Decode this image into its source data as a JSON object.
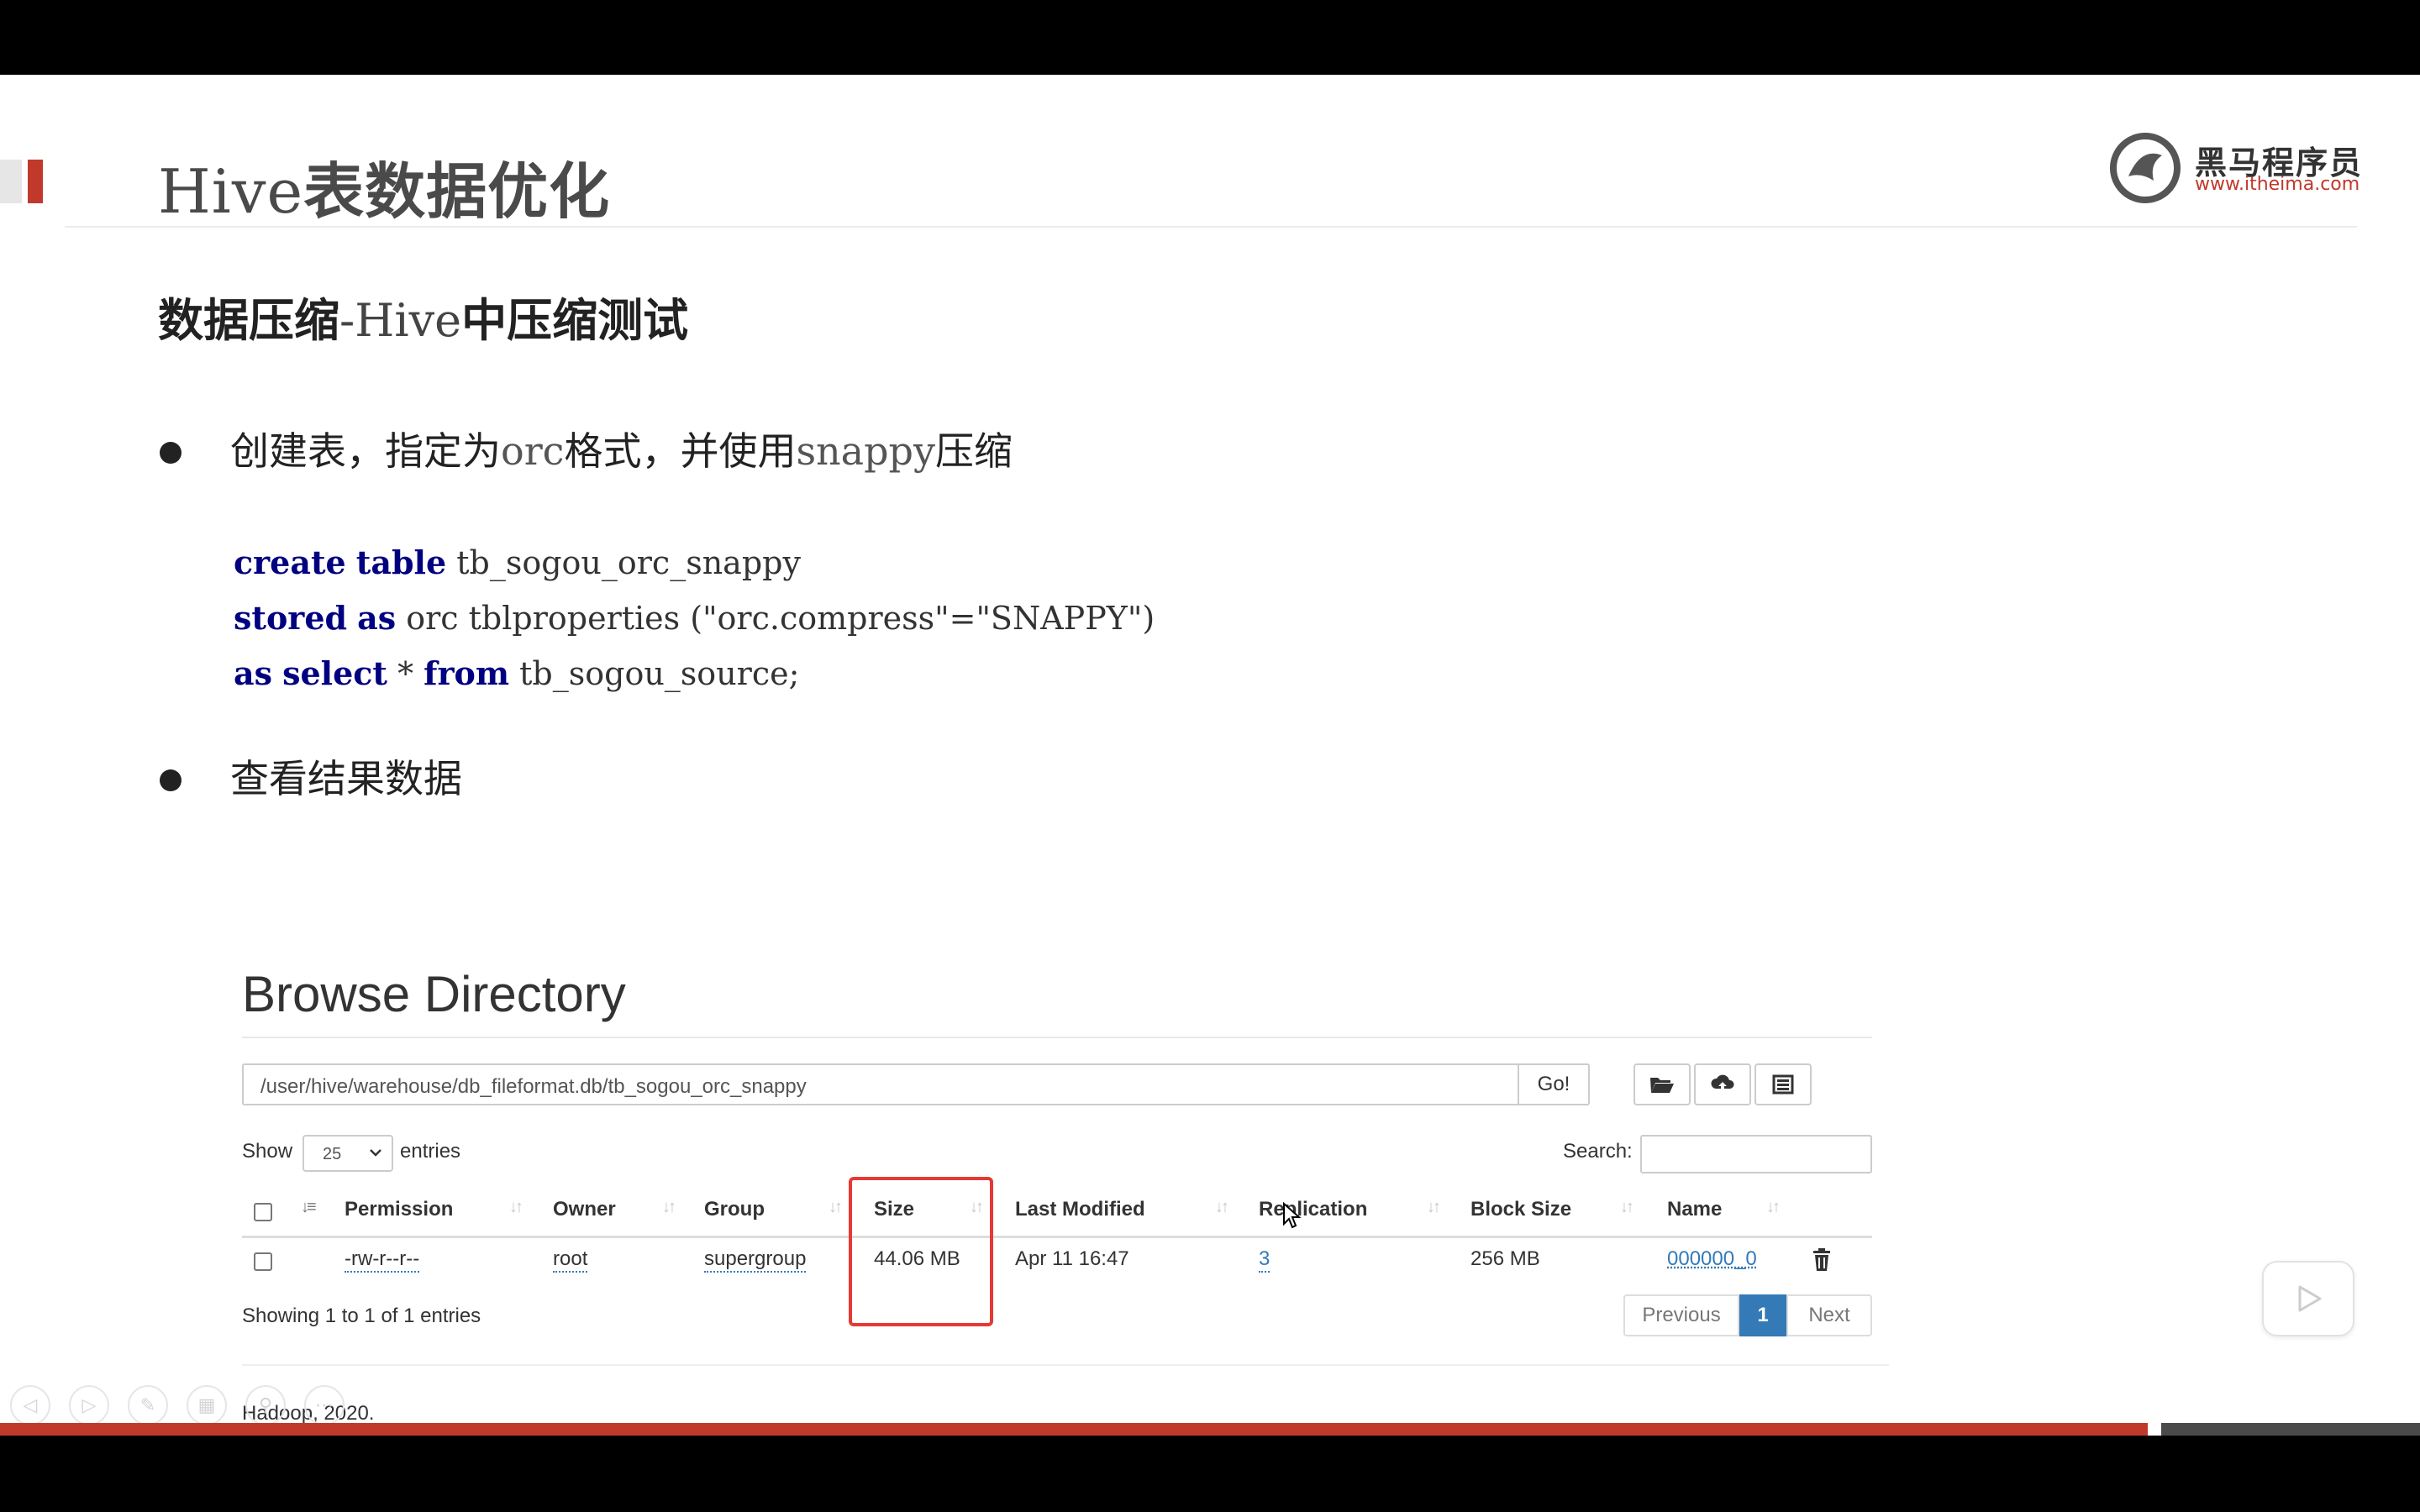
{
  "slide": {
    "title_latin": "Hive",
    "title_cn": "表数据优化",
    "logo_text": "黑马程序员",
    "logo_url": "www.itheima.com",
    "subtitle_part1": "数据压缩",
    "subtitle_part2": "-Hive",
    "subtitle_part3": "中压缩测试",
    "bullet1_parts": [
      "创建表，指定为",
      "orc",
      "格式，并使用",
      "snappy",
      "压缩"
    ],
    "code_lines": [
      [
        {
          "t": "create",
          "kw": true
        },
        {
          "t": " "
        },
        {
          "t": "table",
          "kw": true
        },
        {
          "t": " tb_sogou_orc_snappy"
        }
      ],
      [
        {
          "t": "stored",
          "kw": true
        },
        {
          "t": " "
        },
        {
          "t": "as",
          "kw": true
        },
        {
          "t": " orc tblproperties (\"orc.compress\"=\"SNAPPY\")"
        }
      ],
      [
        {
          "t": "as",
          "kw": true
        },
        {
          "t": " "
        },
        {
          "t": "select",
          "kw": true
        },
        {
          "t": " * "
        },
        {
          "t": "from",
          "kw": true
        },
        {
          "t": " tb_sogou_source;"
        }
      ]
    ],
    "bullet2": "查看结果数据"
  },
  "hdfs": {
    "title": "Browse Directory",
    "path": "/user/hive/warehouse/db_fileformat.db/tb_sogou_orc_snappy",
    "go_label": "Go!",
    "icons": [
      "folder-open-icon",
      "upload-cloud-icon",
      "list-icon"
    ],
    "show_label": "Show",
    "page_length": "25",
    "entries_label": "entries",
    "search_label": "Search:",
    "columns": [
      "Permission",
      "Owner",
      "Group",
      "Size",
      "Last Modified",
      "Replication",
      "Block Size",
      "Name"
    ],
    "row": {
      "permission": "-rw-r--r--",
      "owner": "root",
      "group": "supergroup",
      "size": "44.06 MB",
      "last_modified": "Apr 11 16:47",
      "replication": "3",
      "block_size": "256 MB",
      "name": "000000_0"
    },
    "info": "Showing 1 to 1 of 1 entries",
    "pager": {
      "previous": "Previous",
      "page": "1",
      "next": "Next"
    },
    "footer": "Hadoop, 2020.",
    "highlight_color": "#e53935",
    "link_color": "#337ab7"
  },
  "colors": {
    "accent_red": "#c0392b",
    "code_keyword": "#000080",
    "pager_active": "#337ab7"
  }
}
